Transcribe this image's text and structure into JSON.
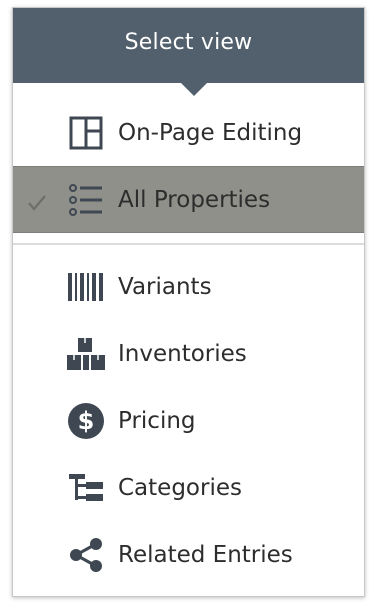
{
  "menu": {
    "title": "Select view",
    "views": [
      {
        "label": "On-Page Editing",
        "icon": "layout-panels-icon",
        "selected": false
      },
      {
        "label": "All Properties",
        "icon": "list-icon",
        "selected": true
      }
    ],
    "tools": [
      {
        "label": "Variants",
        "icon": "barcode-icon"
      },
      {
        "label": "Inventories",
        "icon": "boxes-icon"
      },
      {
        "label": "Pricing",
        "icon": "dollar-circle-icon"
      },
      {
        "label": "Categories",
        "icon": "tree-structure-icon"
      },
      {
        "label": "Related Entries",
        "icon": "share-icon"
      }
    ]
  },
  "colors": {
    "header_bg": "#52606d",
    "selected_bg": "#8f908a",
    "icon": "#3f4852"
  }
}
